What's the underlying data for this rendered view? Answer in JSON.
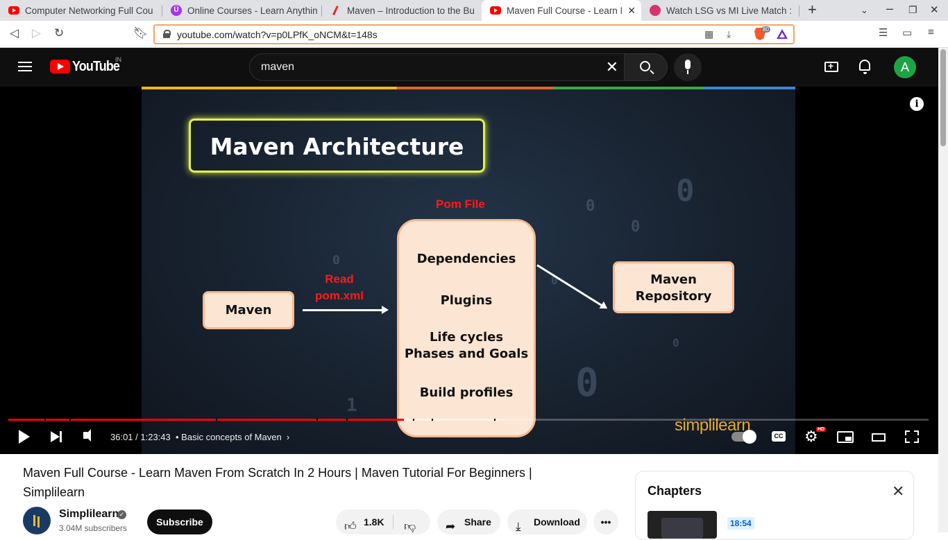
{
  "browser": {
    "tabs": [
      {
        "title": "Computer Networking Full Cou",
        "icon": "youtube-icon"
      },
      {
        "title": "Online Courses - Learn Anythin",
        "icon": "udemy-icon"
      },
      {
        "title": "Maven – Introduction to the Bu",
        "icon": "feather-icon"
      },
      {
        "title": "Maven Full Course - Learn M",
        "icon": "youtube-icon",
        "active": true
      },
      {
        "title": "Watch LSG vs MI Live Match :",
        "icon": "jiocinema-icon"
      }
    ],
    "url": "youtube.com/watch?v=p0LPfK_oNCM&t=148s",
    "brave_shield_count": "80"
  },
  "youtube": {
    "logo_text": "YouTube",
    "region": "IN",
    "search_query": "maven",
    "avatar_letter": "A"
  },
  "slide": {
    "title": "Maven Architecture",
    "pom_label": "Pom File",
    "read_label_line1": "Read",
    "read_label_line2": "pom.xml",
    "maven_box": "Maven",
    "pom_items": [
      "Dependencies",
      "Plugins",
      "Life cycles",
      "Phases and Goals",
      "Build profiles"
    ],
    "repo_line1": "Maven",
    "repo_line2": "Repository",
    "watermark": "simplilearn"
  },
  "player": {
    "current_time": "36:01",
    "duration": "1:23:43",
    "time_display": "36:01 / 1:23:43",
    "chapter": "Basic concepts of Maven",
    "progress_fraction": 0.4302,
    "buffered_fraction": 0.5389,
    "quality_badge": "HD",
    "cc_label": "CC"
  },
  "video": {
    "title": "Maven Full Course - Learn Maven From Scratch In 2 Hours | Maven Tutorial For Beginners | Simplilearn",
    "channel": "Simplilearn",
    "subscribers": "3.04M subscribers",
    "subscribe_label": "Subscribe",
    "likes": "1.8K",
    "share_label": "Share",
    "download_label": "Download"
  },
  "chapters_panel": {
    "heading": "Chapters",
    "first_time": "18:54"
  },
  "colors": {
    "accent_red": "#ff0000",
    "slide_title_border": "#e6f14a",
    "slide_red_text": "#ff1a1a",
    "box_fill": "#fde5d3",
    "omnibox_border": "#f5a55f"
  }
}
